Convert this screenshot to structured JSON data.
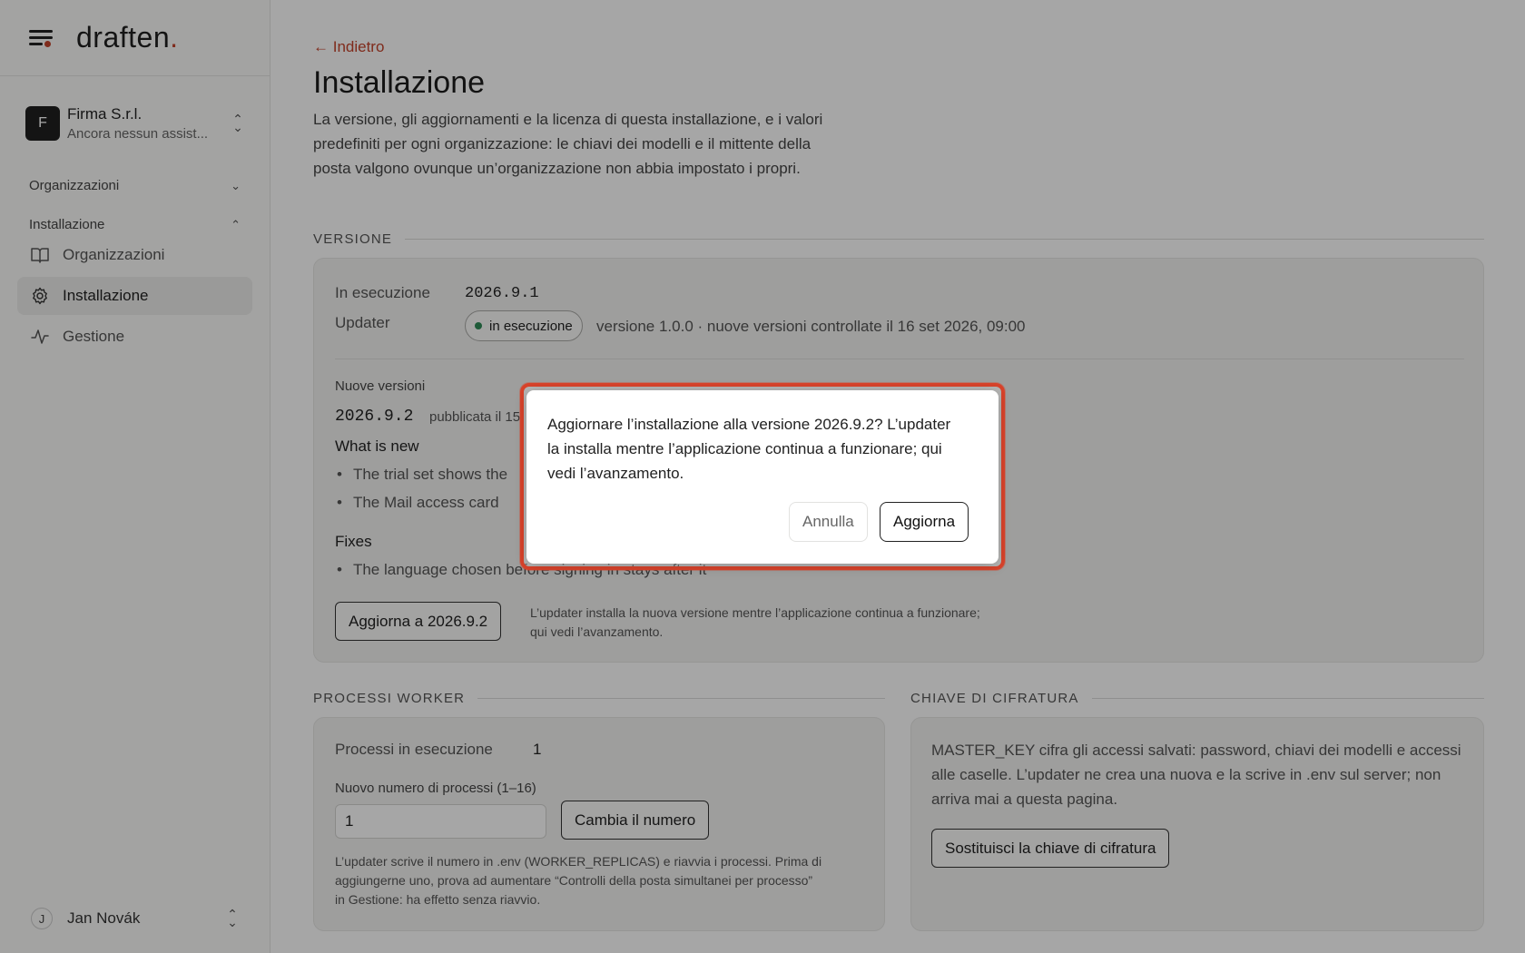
{
  "brand": {
    "name": "draften",
    "dot": "."
  },
  "org": {
    "initial": "F",
    "name": "Firma S.r.l.",
    "sub": "Ancora nessun assist..."
  },
  "nav": {
    "section1": "Organizzazioni",
    "section2": "Installazione",
    "items": [
      {
        "label": "Organizzazioni",
        "icon": "book-icon"
      },
      {
        "label": "Installazione",
        "icon": "gear-icon",
        "active": true
      },
      {
        "label": "Gestione",
        "icon": "activity-icon"
      }
    ]
  },
  "user": {
    "initial": "J",
    "name": "Jan Novák"
  },
  "page": {
    "back": "← Indietro",
    "title": "Installazione",
    "description": "La versione, gli aggiornamenti e la licenza di questa installazione, e i valori predefiniti per ogni organizzazione: le chiavi dei modelli e il mittente della posta valgono ovunque un’organizzazione non abbia impostato i propri."
  },
  "version": {
    "section": "VERSIONE",
    "running_label": "In esecuzione",
    "running_value": "2026.9.1",
    "updater_label": "Updater",
    "updater_badge": "in esecuzione",
    "updater_meta": "versione 1.0.0 · nuove versioni controllate il 16 set 2026, 09:00",
    "new_label": "Nuove versioni",
    "new_version": "2026.9.2",
    "published": "pubblicata il 15",
    "whats_new": "What is new",
    "new_items": [
      "The trial set shows the",
      "The Mail access card"
    ],
    "fixes": "Fixes",
    "fix_items": [
      "The language chosen before signing in stays after it"
    ],
    "update_button": "Aggiorna a 2026.9.2",
    "update_note": "L’updater installa la nuova versione mentre l’applicazione continua a funzionare; qui vedi l’avanzamento."
  },
  "workers": {
    "section": "PROCESSI WORKER",
    "running_label": "Processi in esecuzione",
    "running_value": "1",
    "input_label": "Nuovo numero di processi (1–16)",
    "input_value": "1",
    "button": "Cambia il numero",
    "note": "L’updater scrive il numero in .env (WORKER_REPLICAS) e riavvia i processi. Prima di aggiungerne uno, prova ad aumentare “Controlli della posta simultanei per processo” in Gestione: ha effetto senza riavvio."
  },
  "encryption": {
    "section": "CHIAVE DI CIFRATURA",
    "text": "MASTER_KEY cifra gli accessi salvati: password, chiavi dei modelli e accessi alle caselle. L’updater ne crea una nuova e la scrive in .env sul server; non arriva mai a questa pagina.",
    "button": "Sostituisci la chiave di cifratura"
  },
  "dialog": {
    "text": "Aggiornare l’installazione alla versione 2026.9.2? L’updater la installa mentre l’applicazione continua a funzionare; qui vedi l’avanzamento.",
    "cancel": "Annulla",
    "confirm": "Aggiorna"
  },
  "colors": {
    "accent": "#c4432b",
    "status_ok": "#2e8b57",
    "highlight": "#d9432b"
  }
}
